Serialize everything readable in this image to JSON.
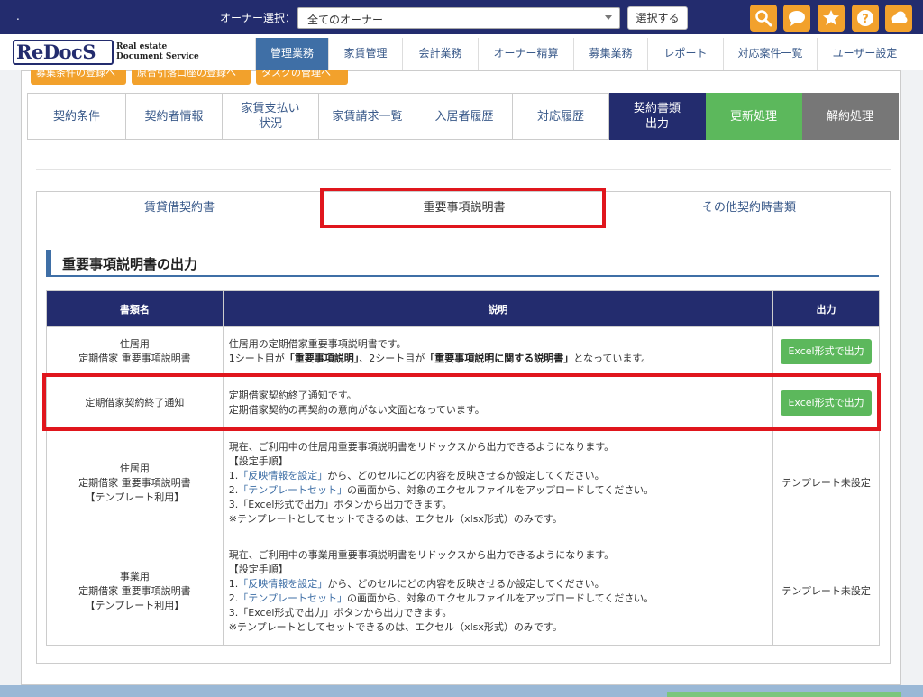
{
  "topbar": {
    "dot": ".",
    "owner_label": "オーナー選択：",
    "owner_select_value": "全てのオーナー",
    "select_button": "選択する",
    "icons": [
      "search-icon",
      "chat-icon",
      "star-icon",
      "help-icon",
      "cloud-icon"
    ],
    "accent": "#f2a12c",
    "bg": "#232c6e"
  },
  "logo": {
    "main": "ReDocS",
    "sub1": "Real estate",
    "sub2": "Document Service"
  },
  "nav": [
    "管理業務",
    "家賃管理",
    "会計業務",
    "オーナー精算",
    "募集業務",
    "レポート",
    "対応案件一覧",
    "ユーザー設定"
  ],
  "orange_buttons": [
    "募集条件の登録へ",
    "原合引落口座の登録へ",
    "タスクの管理へ"
  ],
  "contract_tabs": [
    {
      "label": "契約条件"
    },
    {
      "label": "契約者情報"
    },
    {
      "label1": "家賃支払い",
      "label2": "状況"
    },
    {
      "label": "家賃請求一覧"
    },
    {
      "label": "入居者履歴"
    },
    {
      "label": "対応履歴"
    },
    {
      "label1": "契約書類",
      "label2": "出力"
    },
    {
      "label": "更新処理"
    },
    {
      "label": "解約処理"
    }
  ],
  "sub_tabs": [
    "賃貸借契約書",
    "重要事項説明書",
    "その他契約時書類"
  ],
  "section_title": "重要事項説明書の出力",
  "table": {
    "headers": [
      "書類名",
      "説明",
      "出力"
    ],
    "rows": [
      {
        "name1": "住居用",
        "name2": "定期借家 重要事項説明書",
        "desc1": "住居用の定期借家重要事項説明書です。",
        "desc2a": "1シート目が",
        "desc2b": "「重要事項説明」",
        "desc2c": "、2シート目が",
        "desc2d": "「重要事項説明に関する説明書」",
        "desc2e": "となっています。",
        "out": "Excel形式で出力"
      },
      {
        "name1": "定期借家契約終了通知",
        "desc1": "定期借家契約終了通知です。",
        "desc2": "定期借家契約の再契約の意向がない文面となっています。",
        "out": "Excel形式で出力"
      },
      {
        "name1": "住居用",
        "name2": "定期借家 重要事項説明書",
        "name3": "【テンプレート利用】",
        "d1": "現在、ご利用中の住居用重要事項説明書をリドックスから出力できるようになります。",
        "d2": "【設定手順】",
        "d3a": "1.",
        "d3b": "「反映情報を設定」",
        "d3c": "から、どのセルにどの内容を反映させるか設定してください。",
        "d4a": "2.",
        "d4b": "「テンプレートセット」",
        "d4c": "の画面から、対象のエクセルファイルをアップロードしてください。",
        "d5": "3.「Excel形式で出力」ボタンから出力できます。",
        "d6": "※テンプレートとしてセットできるのは、エクセル（xlsx形式）のみです。",
        "out": "テンプレート未設定"
      },
      {
        "name1": "事業用",
        "name2": "定期借家 重要事項説明書",
        "name3": "【テンプレート利用】",
        "d1": "現在、ご利用中の事業用重要事項説明書をリドックスから出力できるようになります。",
        "d2": "【設定手順】",
        "d3a": "1.",
        "d3b": "「反映情報を設定」",
        "d3c": "から、どのセルにどの内容を反映させるか設定してください。",
        "d4a": "2.",
        "d4b": "「テンプレートセット」",
        "d4c": "の画面から、対象のエクセルファイルをアップロードしてください。",
        "d5": "3.「Excel形式で出力」ボタンから出力できます。",
        "d6": "※テンプレートとしてセットできるのは、エクセル（xlsx形式）のみです。",
        "out": "テンプレート未設定"
      }
    ]
  },
  "colors": {
    "highlight": "#e0161d",
    "green": "#5cb85c",
    "navy": "#232c6e",
    "blue": "#3f6fa6"
  }
}
